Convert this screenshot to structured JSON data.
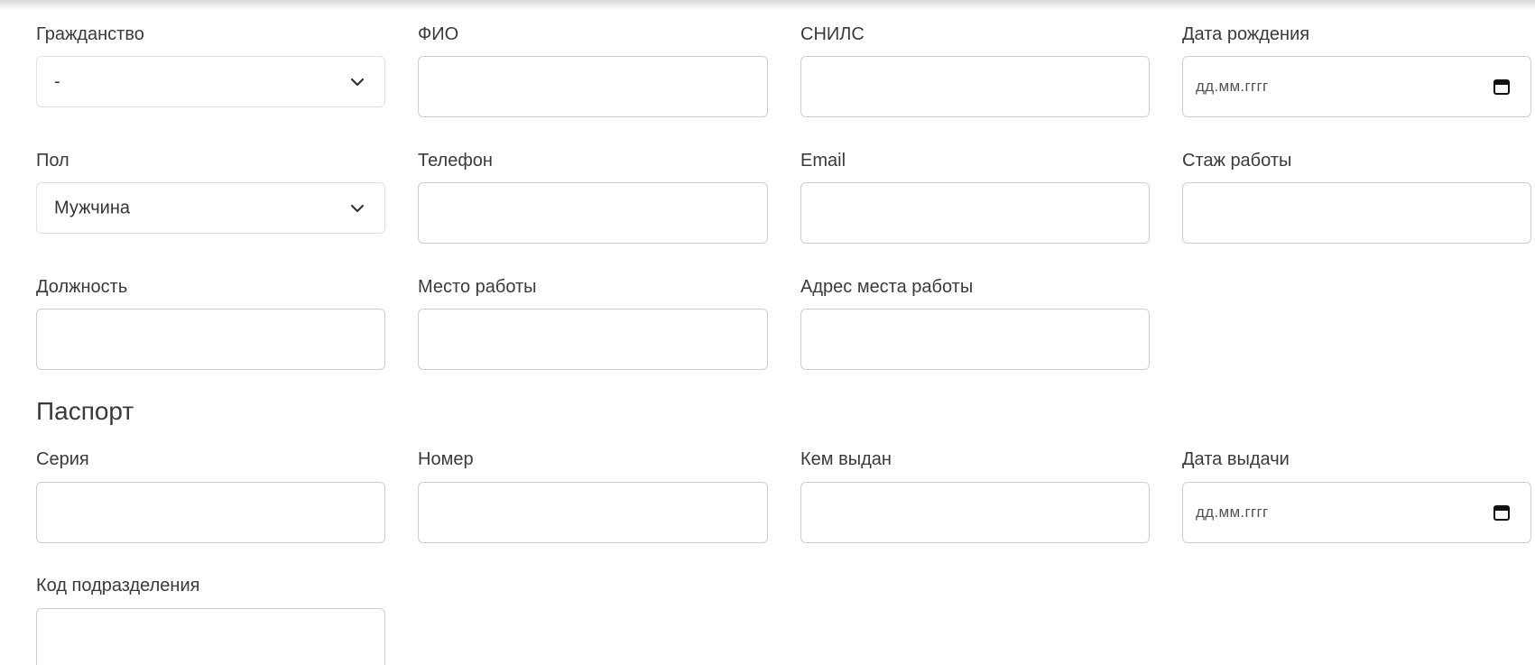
{
  "form": {
    "citizenship": {
      "label": "Гражданство",
      "value": "-"
    },
    "fio": {
      "label": "ФИО",
      "value": ""
    },
    "snils": {
      "label": "СНИЛС",
      "value": ""
    },
    "birth_date": {
      "label": "Дата рождения",
      "placeholder": "дд.мм.гггг"
    },
    "gender": {
      "label": "Пол",
      "value": "Мужчина"
    },
    "phone": {
      "label": "Телефон",
      "value": ""
    },
    "email": {
      "label": "Email",
      "value": ""
    },
    "experience": {
      "label": "Стаж работы",
      "value": ""
    },
    "position": {
      "label": "Должность",
      "value": ""
    },
    "workplace": {
      "label": "Место работы",
      "value": ""
    },
    "work_address": {
      "label": "Адрес места работы",
      "value": ""
    }
  },
  "passport": {
    "title": "Паспорт",
    "series": {
      "label": "Серия",
      "value": ""
    },
    "number": {
      "label": "Номер",
      "value": ""
    },
    "issued_by": {
      "label": "Кем выдан",
      "value": ""
    },
    "issue_date": {
      "label": "Дата выдачи",
      "placeholder": "дд.мм.гггг"
    },
    "division_code": {
      "label": "Код подразделения",
      "value": ""
    }
  },
  "icons": {
    "select_arrow": "chevron-down-icon",
    "date_picker": "calendar-icon"
  }
}
